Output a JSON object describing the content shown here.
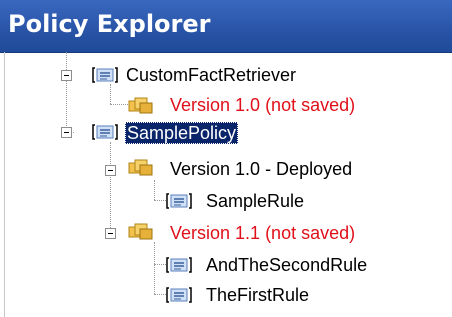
{
  "panel": {
    "title": "Policy Explorer"
  },
  "tree": {
    "nodes": [
      {
        "label": "CustomFactRetriever",
        "kind": "policy"
      },
      {
        "label": "Version 1.0 (not saved)",
        "kind": "version",
        "status": "unsaved"
      },
      {
        "label": "SamplePolicy",
        "kind": "policy",
        "selected": true
      },
      {
        "label": "Version 1.0 - Deployed",
        "kind": "version",
        "status": "deployed"
      },
      {
        "label": "SampleRule",
        "kind": "rule"
      },
      {
        "label": "Version 1.1 (not saved)",
        "kind": "version",
        "status": "unsaved"
      },
      {
        "label": "AndTheSecondRule",
        "kind": "rule"
      },
      {
        "label": "TheFirstRule",
        "kind": "rule"
      }
    ]
  },
  "colors": {
    "title_bar": "#2a55a8",
    "unsaved_text": "#e0101a",
    "selection": "#0a246a"
  }
}
